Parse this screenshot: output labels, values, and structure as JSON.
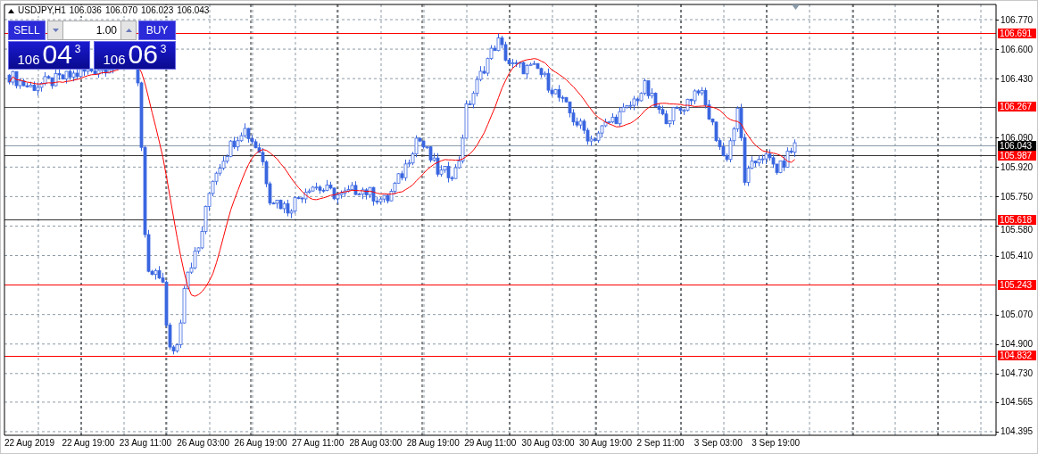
{
  "header": {
    "symbol": "USDJPY,H1",
    "ohlc": [
      "106.036",
      "106.070",
      "106.023",
      "106.043"
    ]
  },
  "trade_panel": {
    "sell_label": "SELL",
    "buy_label": "BUY",
    "lot": "1.00",
    "sell_price": {
      "big_figure": "106",
      "pips": "04",
      "point": "3"
    },
    "buy_price": {
      "big_figure": "106",
      "pips": "06",
      "point": "3"
    }
  },
  "price_axis": [
    "106.770",
    "106.600",
    "106.430",
    "106.090",
    "105.920",
    "105.750",
    "105.580",
    "105.410",
    "105.070",
    "104.900",
    "104.730",
    "104.565",
    "104.395"
  ],
  "levels": [
    {
      "price": "106.691",
      "line": {
        "color": "#ff0000"
      },
      "tag": {
        "color": "#ff0000"
      }
    },
    {
      "price": "106.267",
      "line": {
        "color": "#555555"
      },
      "tag": {
        "color": "#ff0000"
      }
    },
    {
      "price": "106.043",
      "line": {
        "color": "#8a9aa8"
      },
      "tag": {
        "color": "#000000"
      }
    },
    {
      "price": "105.987",
      "line": {
        "color": "#333333"
      },
      "tag": {
        "color": "#ff0000"
      }
    },
    {
      "price": "105.618",
      "line": {
        "color": "#333333"
      },
      "tag": {
        "color": "#ff0000"
      }
    },
    {
      "price": "105.243",
      "line": {
        "color": "#ff0000"
      },
      "tag": {
        "color": "#ff0000"
      }
    },
    {
      "price": "104.832",
      "line": {
        "color": "#ff0000"
      },
      "tag": {
        "color": "#ff0000"
      }
    }
  ],
  "time_axis": [
    "22 Aug 2019",
    "22 Aug 19:00",
    "23 Aug 11:00",
    "26 Aug 03:00",
    "26 Aug 19:00",
    "27 Aug 11:00",
    "28 Aug 03:00",
    "28 Aug 19:00",
    "29 Aug 11:00",
    "30 Aug 03:00",
    "30 Aug 19:00",
    "2 Sep 11:00",
    "3 Sep 03:00",
    "3 Sep 19:00"
  ]
}
